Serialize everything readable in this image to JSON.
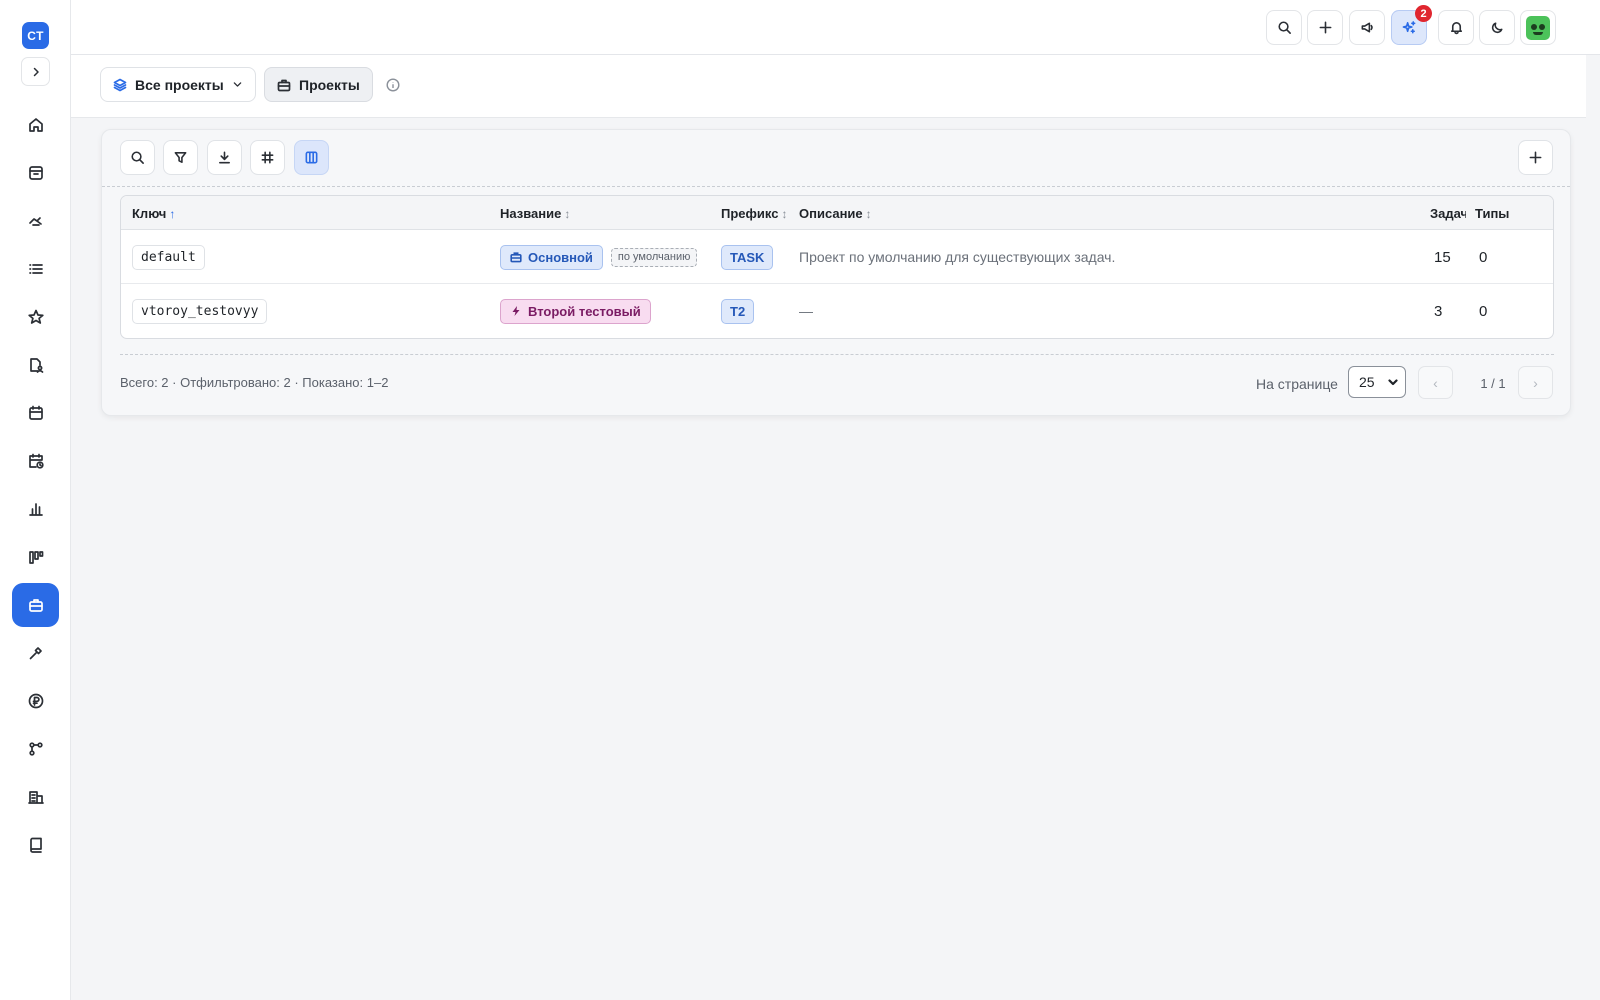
{
  "app": {
    "logo_text": "CT"
  },
  "sidebar": {
    "items": [
      {
        "name": "home-icon",
        "active": false
      },
      {
        "name": "inbox-icon",
        "active": false
      },
      {
        "name": "handshake-icon",
        "active": false
      },
      {
        "name": "list-icon",
        "active": false
      },
      {
        "name": "star-icon",
        "active": false
      },
      {
        "name": "document-user-icon",
        "active": false
      },
      {
        "name": "calendar-icon",
        "active": false
      },
      {
        "name": "calendar-clock-icon",
        "active": false
      },
      {
        "name": "bar-chart-icon",
        "active": false
      },
      {
        "name": "kanban-icon",
        "active": false
      },
      {
        "name": "briefcase-icon",
        "active": true
      },
      {
        "name": "wrench-icon",
        "active": false
      },
      {
        "name": "ruble-icon",
        "active": false
      },
      {
        "name": "workflow-icon",
        "active": false
      },
      {
        "name": "building-icon",
        "active": false
      },
      {
        "name": "book-icon",
        "active": false
      }
    ]
  },
  "topbar": {
    "notifications_badge": "2"
  },
  "subheader": {
    "all_projects_label": "Все проекты",
    "projects_label": "Проекты"
  },
  "table": {
    "columns": {
      "key": "Ключ",
      "name": "Название",
      "prefix": "Префикс",
      "description": "Описание",
      "tasks": "Задачи",
      "types": "Типы"
    },
    "rows": [
      {
        "key": "default",
        "name": "Основной",
        "default_tag": "по умолчанию",
        "prefix": "TASK",
        "description": "Проект по умолчанию для существующих задач.",
        "tasks": "15",
        "types": "0"
      },
      {
        "key": "vtoroy_testovyy",
        "name": "Второй тестовый",
        "prefix": "T2",
        "description": "—",
        "tasks": "3",
        "types": "0"
      }
    ]
  },
  "footer": {
    "summary": "Всего: 2 · Отфильтровано: 2 · Показано: 1–2",
    "per_page_label": "На странице",
    "per_page_value": "25",
    "prev": "‹",
    "next": "›",
    "page_info": "1 / 1"
  },
  "colors": {
    "accent": "#2a6be6",
    "badge_red": "#e0262f",
    "pink_badge": "#f8dcf0"
  }
}
